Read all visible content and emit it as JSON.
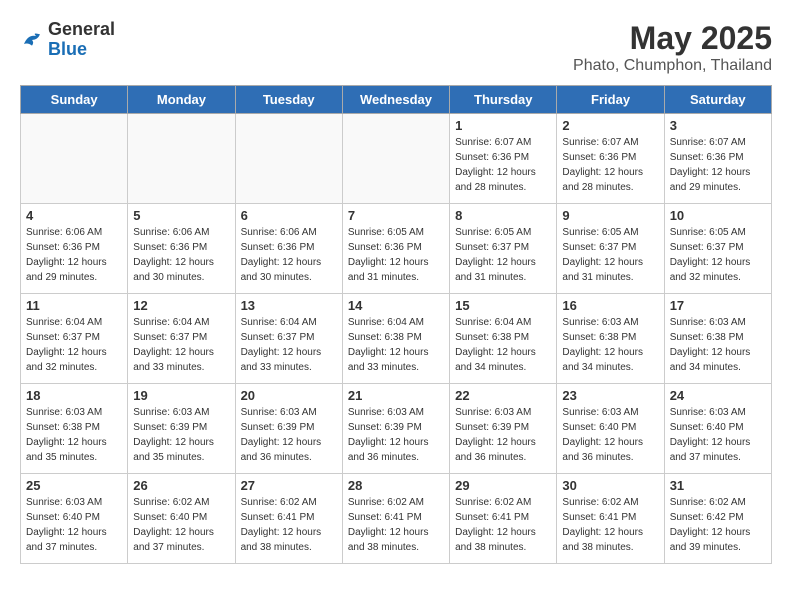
{
  "header": {
    "logo_general": "General",
    "logo_blue": "Blue",
    "main_title": "May 2025",
    "subtitle": "Phato, Chumphon, Thailand"
  },
  "days_of_week": [
    "Sunday",
    "Monday",
    "Tuesday",
    "Wednesday",
    "Thursday",
    "Friday",
    "Saturday"
  ],
  "weeks": [
    [
      {
        "day": "",
        "info": ""
      },
      {
        "day": "",
        "info": ""
      },
      {
        "day": "",
        "info": ""
      },
      {
        "day": "",
        "info": ""
      },
      {
        "day": "1",
        "info": "Sunrise: 6:07 AM\nSunset: 6:36 PM\nDaylight: 12 hours\nand 28 minutes."
      },
      {
        "day": "2",
        "info": "Sunrise: 6:07 AM\nSunset: 6:36 PM\nDaylight: 12 hours\nand 28 minutes."
      },
      {
        "day": "3",
        "info": "Sunrise: 6:07 AM\nSunset: 6:36 PM\nDaylight: 12 hours\nand 29 minutes."
      }
    ],
    [
      {
        "day": "4",
        "info": "Sunrise: 6:06 AM\nSunset: 6:36 PM\nDaylight: 12 hours\nand 29 minutes."
      },
      {
        "day": "5",
        "info": "Sunrise: 6:06 AM\nSunset: 6:36 PM\nDaylight: 12 hours\nand 30 minutes."
      },
      {
        "day": "6",
        "info": "Sunrise: 6:06 AM\nSunset: 6:36 PM\nDaylight: 12 hours\nand 30 minutes."
      },
      {
        "day": "7",
        "info": "Sunrise: 6:05 AM\nSunset: 6:36 PM\nDaylight: 12 hours\nand 31 minutes."
      },
      {
        "day": "8",
        "info": "Sunrise: 6:05 AM\nSunset: 6:37 PM\nDaylight: 12 hours\nand 31 minutes."
      },
      {
        "day": "9",
        "info": "Sunrise: 6:05 AM\nSunset: 6:37 PM\nDaylight: 12 hours\nand 31 minutes."
      },
      {
        "day": "10",
        "info": "Sunrise: 6:05 AM\nSunset: 6:37 PM\nDaylight: 12 hours\nand 32 minutes."
      }
    ],
    [
      {
        "day": "11",
        "info": "Sunrise: 6:04 AM\nSunset: 6:37 PM\nDaylight: 12 hours\nand 32 minutes."
      },
      {
        "day": "12",
        "info": "Sunrise: 6:04 AM\nSunset: 6:37 PM\nDaylight: 12 hours\nand 33 minutes."
      },
      {
        "day": "13",
        "info": "Sunrise: 6:04 AM\nSunset: 6:37 PM\nDaylight: 12 hours\nand 33 minutes."
      },
      {
        "day": "14",
        "info": "Sunrise: 6:04 AM\nSunset: 6:38 PM\nDaylight: 12 hours\nand 33 minutes."
      },
      {
        "day": "15",
        "info": "Sunrise: 6:04 AM\nSunset: 6:38 PM\nDaylight: 12 hours\nand 34 minutes."
      },
      {
        "day": "16",
        "info": "Sunrise: 6:03 AM\nSunset: 6:38 PM\nDaylight: 12 hours\nand 34 minutes."
      },
      {
        "day": "17",
        "info": "Sunrise: 6:03 AM\nSunset: 6:38 PM\nDaylight: 12 hours\nand 34 minutes."
      }
    ],
    [
      {
        "day": "18",
        "info": "Sunrise: 6:03 AM\nSunset: 6:38 PM\nDaylight: 12 hours\nand 35 minutes."
      },
      {
        "day": "19",
        "info": "Sunrise: 6:03 AM\nSunset: 6:39 PM\nDaylight: 12 hours\nand 35 minutes."
      },
      {
        "day": "20",
        "info": "Sunrise: 6:03 AM\nSunset: 6:39 PM\nDaylight: 12 hours\nand 36 minutes."
      },
      {
        "day": "21",
        "info": "Sunrise: 6:03 AM\nSunset: 6:39 PM\nDaylight: 12 hours\nand 36 minutes."
      },
      {
        "day": "22",
        "info": "Sunrise: 6:03 AM\nSunset: 6:39 PM\nDaylight: 12 hours\nand 36 minutes."
      },
      {
        "day": "23",
        "info": "Sunrise: 6:03 AM\nSunset: 6:40 PM\nDaylight: 12 hours\nand 36 minutes."
      },
      {
        "day": "24",
        "info": "Sunrise: 6:03 AM\nSunset: 6:40 PM\nDaylight: 12 hours\nand 37 minutes."
      }
    ],
    [
      {
        "day": "25",
        "info": "Sunrise: 6:03 AM\nSunset: 6:40 PM\nDaylight: 12 hours\nand 37 minutes."
      },
      {
        "day": "26",
        "info": "Sunrise: 6:02 AM\nSunset: 6:40 PM\nDaylight: 12 hours\nand 37 minutes."
      },
      {
        "day": "27",
        "info": "Sunrise: 6:02 AM\nSunset: 6:41 PM\nDaylight: 12 hours\nand 38 minutes."
      },
      {
        "day": "28",
        "info": "Sunrise: 6:02 AM\nSunset: 6:41 PM\nDaylight: 12 hours\nand 38 minutes."
      },
      {
        "day": "29",
        "info": "Sunrise: 6:02 AM\nSunset: 6:41 PM\nDaylight: 12 hours\nand 38 minutes."
      },
      {
        "day": "30",
        "info": "Sunrise: 6:02 AM\nSunset: 6:41 PM\nDaylight: 12 hours\nand 38 minutes."
      },
      {
        "day": "31",
        "info": "Sunrise: 6:02 AM\nSunset: 6:42 PM\nDaylight: 12 hours\nand 39 minutes."
      }
    ]
  ]
}
